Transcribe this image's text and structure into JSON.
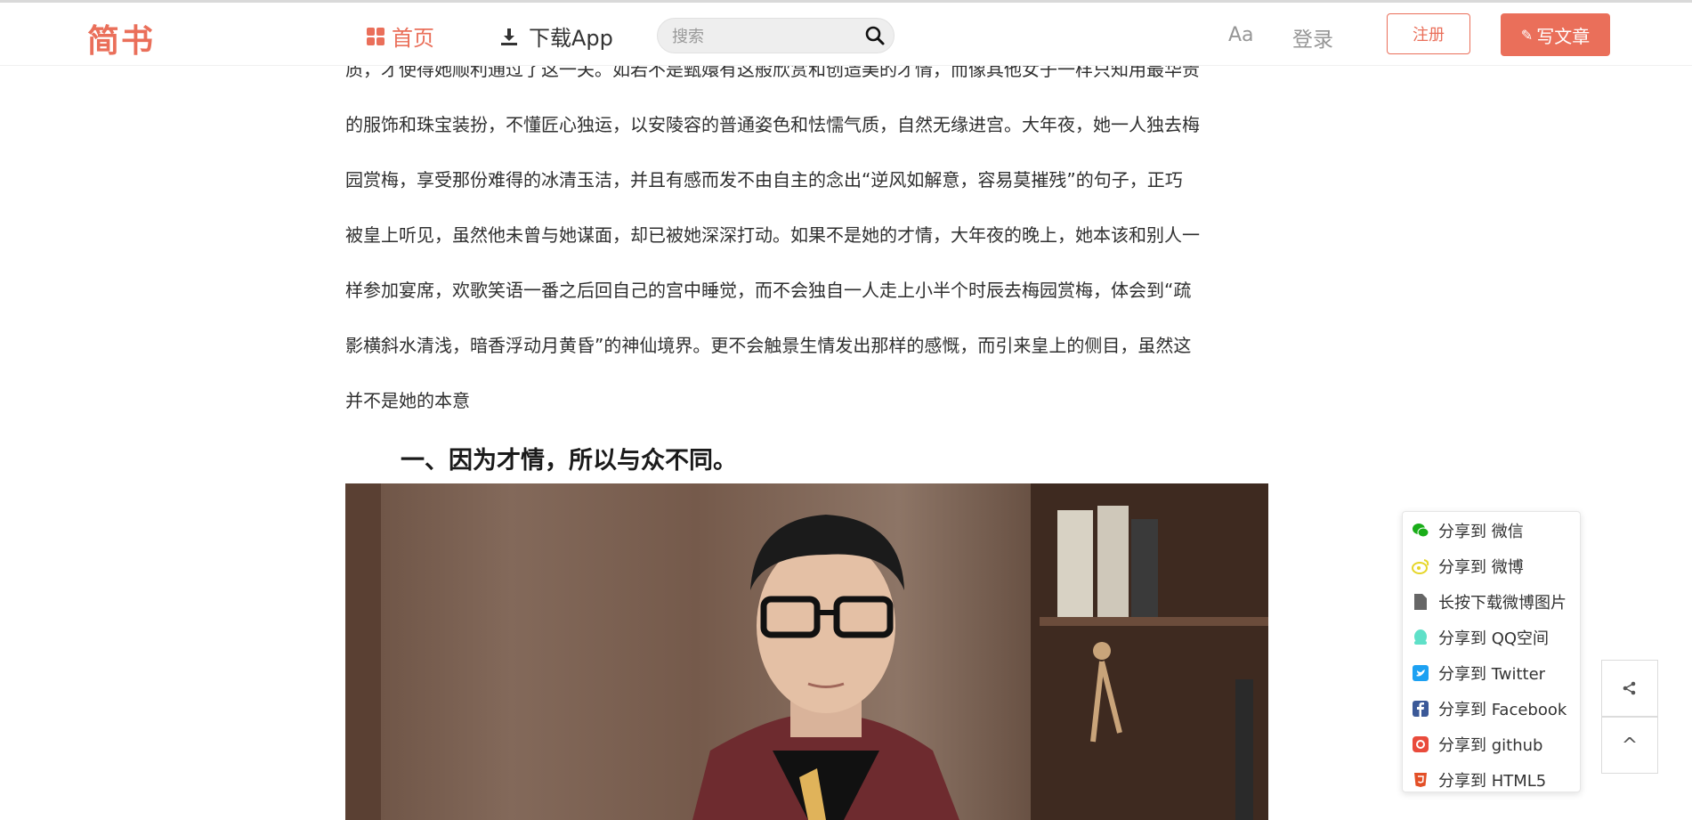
{
  "nav": {
    "logo": "简书",
    "home_label": "首页",
    "app_label": "下载App",
    "search_placeholder": "搜索",
    "aa_label": "Aa",
    "login_label": "登录",
    "signup_label": "注册",
    "write_label": "写文章"
  },
  "article": {
    "lines": [
      "质，才使得她顺利通过了这一关。如若不是甄嬛有这般欣赏和创造美的才情，而像其他女子一样只知用最华贵",
      "的服饰和珠宝装扮，不懂匠心独运，以安陵容的普通姿色和怯懦气质，自然无缘进宫。大年夜，她一人独去梅",
      "园赏梅，享受那份难得的冰清玉洁，并且有感而发不由自主的念出“逆风如解意，容易莫摧残”的句子，正巧",
      "被皇上听见，虽然他未曾与她谋面，却已被她深深打动。如果不是她的才情，大年夜的晚上，她本该和别人一",
      "样参加宴席，欢歌笑语一番之后回自己的宫中睡觉，而不会独自一人走上小半个时辰去梅园赏梅，体会到“疏",
      "影横斜水清浅，暗香浮动月黄昏”的神仙境界。更不会触景生情发出那样的感慨，而引来皇上的侧目，虽然这",
      "并不是她的本意"
    ],
    "heading": "一、因为才情，所以与众不同。"
  },
  "share": {
    "items": [
      {
        "label": "分享到 微信",
        "icon": "wechat-icon",
        "color": "#1aad19"
      },
      {
        "label": "分享到 微博",
        "icon": "weibo-icon",
        "color": "#e6d629"
      },
      {
        "label": "长按下载微博图片",
        "icon": "file-icon",
        "color": "#666666"
      },
      {
        "label": "分享到 QQ空间",
        "icon": "qq-icon",
        "color": "#5fe0c8"
      },
      {
        "label": "分享到 Twitter",
        "icon": "twitter-icon",
        "color": "#1da1f2"
      },
      {
        "label": "分享到 Facebook",
        "icon": "facebook-icon",
        "color": "#3b5998"
      },
      {
        "label": "分享到 github",
        "icon": "github-icon",
        "color": "#e94b3c"
      },
      {
        "label": "分享到 HTML5",
        "icon": "html5-icon",
        "color": "#e34f26"
      }
    ]
  },
  "side": {
    "share_icon": "share-icon",
    "top_icon": "back-to-top-icon",
    "top_glyph": "^"
  },
  "colors": {
    "accent": "#ea6f5a"
  }
}
